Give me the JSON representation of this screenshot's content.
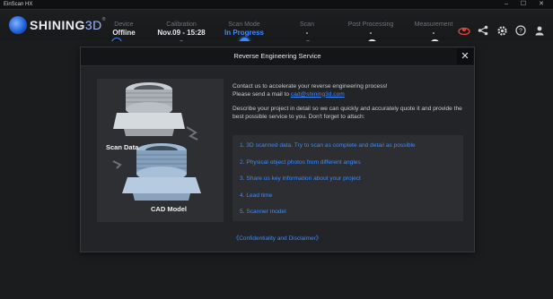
{
  "window": {
    "title": "EinScan HX",
    "controls": "–  ☐  ✕"
  },
  "logo": {
    "brand": "SHINING",
    "suffix": "3D",
    "reg": "®"
  },
  "steps": [
    {
      "label": "Device",
      "value": "Offline"
    },
    {
      "label": "Calibration",
      "value": "Nov.09 - 15:28"
    },
    {
      "label": "Scan Mode",
      "value": "In Progress"
    },
    {
      "label": "Scan",
      "value": "-"
    },
    {
      "label": "Post Processing",
      "value": "-"
    },
    {
      "label": "Measurement",
      "value": "-"
    }
  ],
  "toolbar": {
    "icons": [
      "record-icon",
      "share-icon",
      "settings-icon",
      "help-icon",
      "user-icon"
    ]
  },
  "dialog": {
    "title": "Reverse Engineering Service",
    "close": "✕",
    "intro_line1": "Contact us to accelerate your reverse engineering process!",
    "intro_line2_prefix": "Please send a mail to ",
    "email": "cad@shining3d.com",
    "describe": "Describe your project in detail so we can quickly and accurately quote it and provide the best possible service to you. Don't forget to attach:",
    "items": [
      "1. 3D scanned data. Try to scan as complete and detail as possible",
      "2. Physical object photos from different angles",
      "3. Share us key information about your project",
      "4. Lead time",
      "5. Scanner model"
    ],
    "disclaimer": "《Confidentiality and Disclaimer》",
    "illustration": {
      "caption_scan": "Scan Data",
      "caption_cad": "CAD Model"
    }
  },
  "colors": {
    "accent": "#3d8bff",
    "background": "#1b1c1e",
    "panel": "#232427",
    "alert": "#d9453c"
  }
}
